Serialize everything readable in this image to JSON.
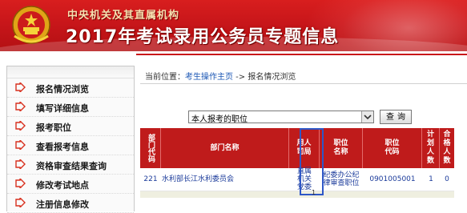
{
  "header": {
    "org_text": "中央机关及其直属机构",
    "title": "2017年考试录用公务员专题信息"
  },
  "sidebar": {
    "items": [
      {
        "label": "报名情况浏览"
      },
      {
        "label": "填写详细信息"
      },
      {
        "label": "报考职位"
      },
      {
        "label": "查看报考信息"
      },
      {
        "label": "资格审查结果查询"
      },
      {
        "label": "修改考试地点"
      },
      {
        "label": "注册信息修改"
      }
    ]
  },
  "breadcrumb": {
    "prefix": "当前位置：",
    "link": "考生操作主页",
    "suffix": " -> 报名情况浏览"
  },
  "filter": {
    "select_value": "本人报考的职位",
    "query_label": "查询"
  },
  "table": {
    "headers": [
      "部门代码",
      "部门名称",
      "用人司局",
      "职位名称",
      "职位代码",
      "计划人数",
      "合格人数"
    ],
    "rows": [
      [
        "221",
        "水利部长江水利委员会",
        "直属机关党委",
        "纪委办公纪律审查职位",
        "0901005001",
        "1",
        "0"
      ]
    ],
    "footer_num": "1"
  },
  "colors": {
    "brand_red": "#c8161a",
    "highlight_blue": "#2e57c7",
    "link_blue": "#1a56b4"
  }
}
